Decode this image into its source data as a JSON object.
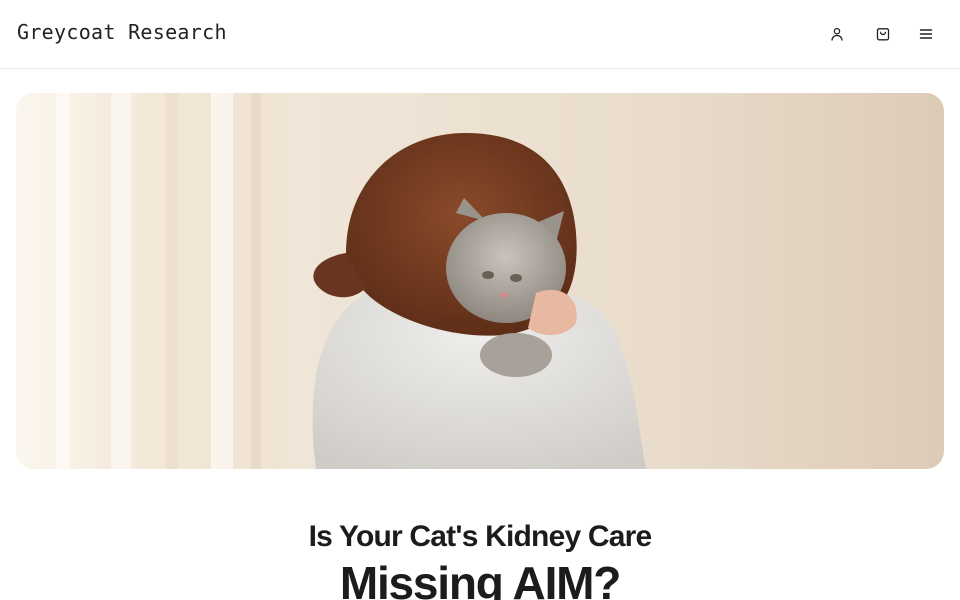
{
  "header": {
    "brand": "Greycoat Research",
    "icons": [
      "account-icon",
      "cart-icon",
      "menu-icon"
    ]
  },
  "hero": {
    "image": "woman-hugging-grey-tabby-cat-photo"
  },
  "main": {
    "headline_line1": "Is Your Cat's Kidney Care",
    "headline_line2": "Missing AIM?"
  }
}
